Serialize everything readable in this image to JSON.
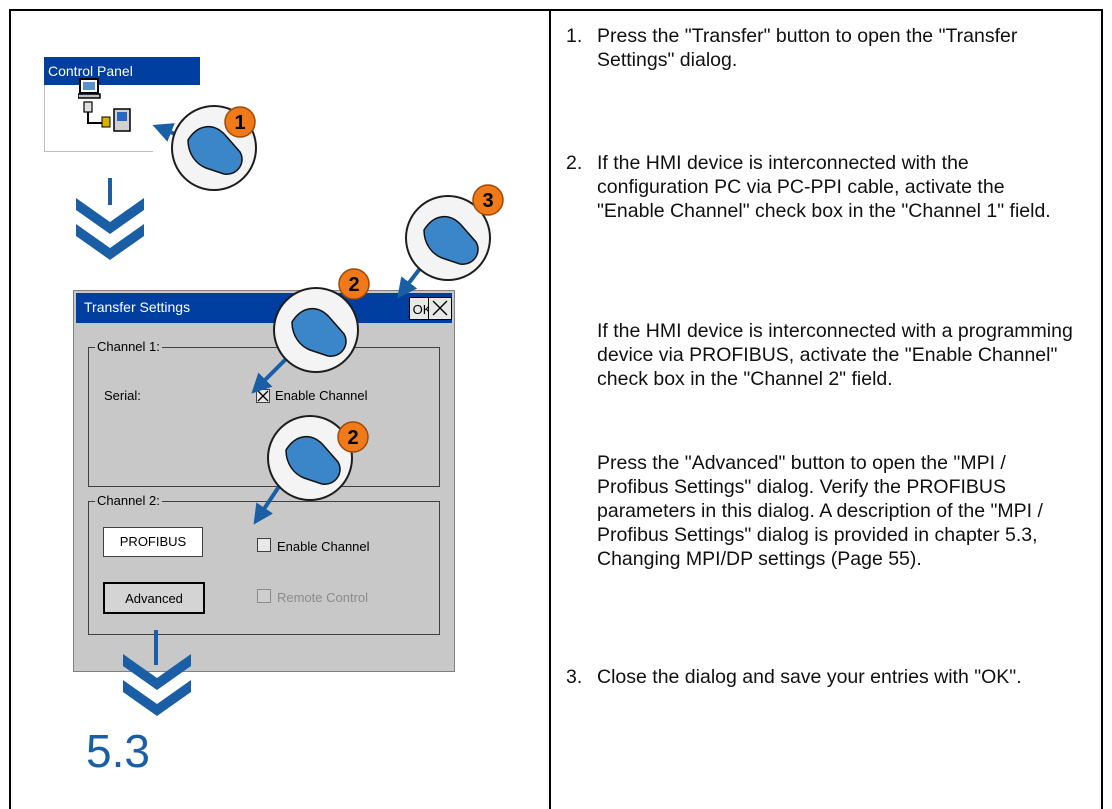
{
  "illustration": {
    "control_panel_title": "Control Panel",
    "dialog": {
      "title": "Transfer Settings",
      "ok_label": "OK",
      "channel1": {
        "legend": "Channel 1:",
        "serial_label": "Serial:",
        "enable_label": "Enable Channel",
        "enable_checked": true
      },
      "channel2": {
        "legend": "Channel 2:",
        "profibus_value": "PROFIBUS",
        "enable_label": "Enable Channel",
        "enable_checked": false,
        "advanced_label": "Advanced",
        "remote_label": "Remote Control",
        "remote_enabled": false
      }
    },
    "callouts": [
      "1",
      "2",
      "2",
      "3"
    ],
    "chapter_ref": "5.3",
    "colors": {
      "titlebar": "#003fa0",
      "callout_orange": "#f07a1a",
      "arrow_blue": "#1a5fa6",
      "hand_blue": "#3a86c8",
      "dialog_gray": "#c8c8c8"
    }
  },
  "steps": [
    {
      "number": "1.",
      "text": "Press the \"Transfer\" button to open the \"Transfer Settings\" dialog."
    },
    {
      "number": "2.",
      "text": "If the HMI device is interconnected with the configuration PC via PC-PPI cable, activate the \"Enable Channel\" check box in the \"Channel 1\" field.",
      "paragraphs": [
        "If the HMI device is interconnected with a programming device via PROFIBUS, activate the \"Enable Channel\" check box in the \"Channel 2\" field.",
        "Press the \"Advanced\" button to open the \"MPI / Profibus Settings\" dialog. Verify the PROFIBUS parameters in this dialog. A description of the \"MPI / Profibus Settings\" dialog is provided in chapter 5.3, Changing MPI/DP settings (Page 55)."
      ]
    },
    {
      "number": "3.",
      "text": "Close the dialog and save your entries with \"OK\"."
    }
  ]
}
